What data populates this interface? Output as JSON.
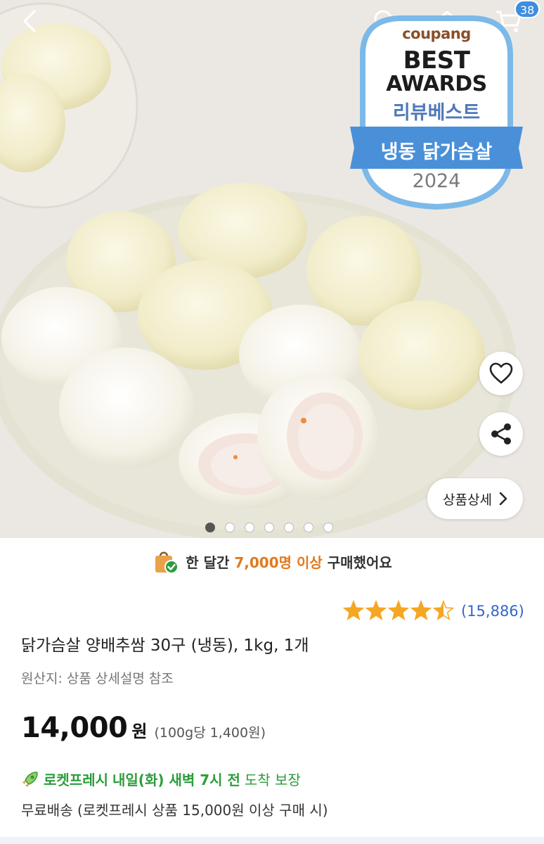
{
  "header": {
    "back_icon": "back-chevron-icon",
    "search_icon": "search-icon",
    "home_icon": "home-icon",
    "cart_icon": "cart-icon",
    "cart_count": "38"
  },
  "award_badge": {
    "brand": "coupang",
    "line1": "BEST",
    "line2": "AWARDS",
    "line3": "리뷰베스트",
    "ribbon": "냉동 닭가슴살",
    "year": "2024",
    "colors": {
      "ring": "#7cb9e8",
      "ribbon": "#4a90d9",
      "review": "#4f79b8"
    }
  },
  "image_actions": {
    "heart_icon": "heart-outline-icon",
    "share_icon": "share-icon",
    "detail_label": "상품상세",
    "detail_icon": "chevron-right-icon"
  },
  "carousel": {
    "total": 7,
    "active_index": 0
  },
  "purchase_banner": {
    "icon": "shopping-bag-check-icon",
    "prefix": "한 달간",
    "highlight": "7,000명 이상",
    "suffix": "구매했어요",
    "highlight_color": "#e07a1f"
  },
  "rating": {
    "stars": 4.5,
    "count_text": "(15,886)",
    "star_color": "#f5a623"
  },
  "product": {
    "title": "닭가슴살 양배추쌈 30구 (냉동), 1kg, 1개",
    "origin": "원산지: 상품 상세설명 참조",
    "price": "14,000",
    "price_unit": "원",
    "unit_price": "(100g당 1,400원)"
  },
  "delivery": {
    "icon": "rocket-icon",
    "brand": "로켓프레시",
    "eta": "내일(화) 새벽 7시 전",
    "guarantee": "도착 보장",
    "color": "#2a9d3a",
    "shipping_note": "무료배송 (로켓프레시 상품 15,000원 이상 구매 시)"
  }
}
